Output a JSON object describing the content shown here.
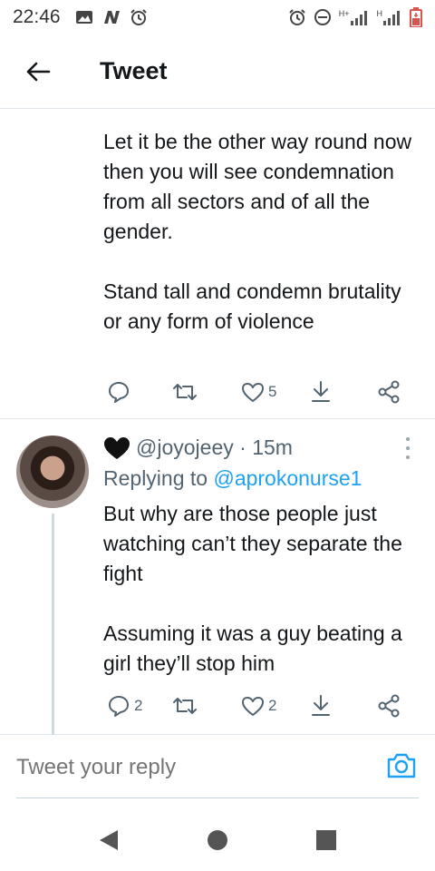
{
  "status_bar": {
    "time": "22:46",
    "left_icons": [
      "image-icon",
      "n-app-icon",
      "alarm-icon"
    ],
    "right_icons": [
      "alarm-icon",
      "dnd-icon",
      "signal-h-plus-icon",
      "signal-h-icon",
      "battery-icon"
    ],
    "net_label_1": "H+",
    "net_label_2": "H"
  },
  "header": {
    "title": "Tweet"
  },
  "tweet1": {
    "text": "Let it be the other way round now then you will see condemnation from all sectors and of all the gender.\n\nStand tall and condemn brutality or any form of violence",
    "actions": {
      "reply_count": "",
      "retweet_count": "",
      "like_count": "5"
    }
  },
  "tweet2": {
    "handle": "@joyojeey",
    "separator": " · ",
    "time": "15m",
    "replying_prefix": "Replying to ",
    "replying_to": "@aprokonurse1",
    "text": "But why are those people just watching can’t they separate the fight\n\nAssuming it was a guy beating a girl they’ll stop him",
    "actions": {
      "reply_count": "2",
      "retweet_count": "",
      "like_count": "2"
    }
  },
  "composer": {
    "placeholder": "Tweet your reply"
  },
  "colors": {
    "accent": "#1da1f2",
    "text": "#14171a",
    "secondary": "#536471",
    "divider": "#e1e8ed"
  }
}
